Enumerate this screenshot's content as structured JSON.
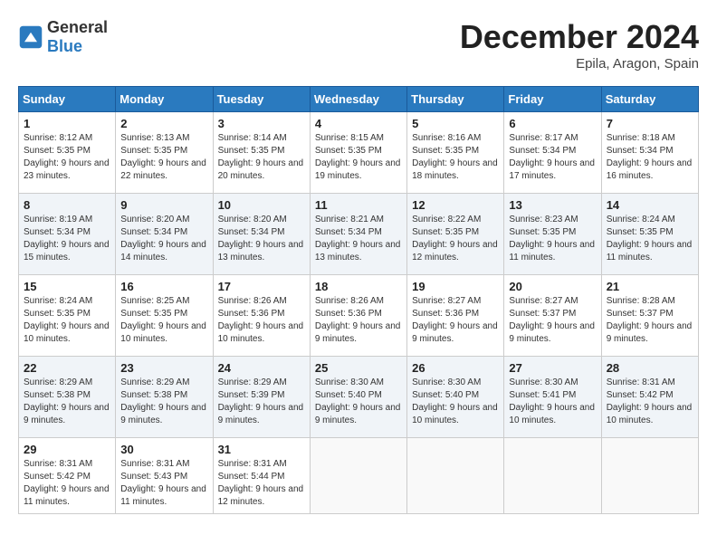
{
  "header": {
    "logo_general": "General",
    "logo_blue": "Blue",
    "month": "December 2024",
    "location": "Epila, Aragon, Spain"
  },
  "weekdays": [
    "Sunday",
    "Monday",
    "Tuesday",
    "Wednesday",
    "Thursday",
    "Friday",
    "Saturday"
  ],
  "weeks": [
    [
      {
        "day": "1",
        "sunrise": "8:12 AM",
        "sunset": "5:35 PM",
        "daylight": "9 hours and 23 minutes."
      },
      {
        "day": "2",
        "sunrise": "8:13 AM",
        "sunset": "5:35 PM",
        "daylight": "9 hours and 22 minutes."
      },
      {
        "day": "3",
        "sunrise": "8:14 AM",
        "sunset": "5:35 PM",
        "daylight": "9 hours and 20 minutes."
      },
      {
        "day": "4",
        "sunrise": "8:15 AM",
        "sunset": "5:35 PM",
        "daylight": "9 hours and 19 minutes."
      },
      {
        "day": "5",
        "sunrise": "8:16 AM",
        "sunset": "5:35 PM",
        "daylight": "9 hours and 18 minutes."
      },
      {
        "day": "6",
        "sunrise": "8:17 AM",
        "sunset": "5:34 PM",
        "daylight": "9 hours and 17 minutes."
      },
      {
        "day": "7",
        "sunrise": "8:18 AM",
        "sunset": "5:34 PM",
        "daylight": "9 hours and 16 minutes."
      }
    ],
    [
      {
        "day": "8",
        "sunrise": "8:19 AM",
        "sunset": "5:34 PM",
        "daylight": "9 hours and 15 minutes."
      },
      {
        "day": "9",
        "sunrise": "8:20 AM",
        "sunset": "5:34 PM",
        "daylight": "9 hours and 14 minutes."
      },
      {
        "day": "10",
        "sunrise": "8:20 AM",
        "sunset": "5:34 PM",
        "daylight": "9 hours and 13 minutes."
      },
      {
        "day": "11",
        "sunrise": "8:21 AM",
        "sunset": "5:34 PM",
        "daylight": "9 hours and 13 minutes."
      },
      {
        "day": "12",
        "sunrise": "8:22 AM",
        "sunset": "5:35 PM",
        "daylight": "9 hours and 12 minutes."
      },
      {
        "day": "13",
        "sunrise": "8:23 AM",
        "sunset": "5:35 PM",
        "daylight": "9 hours and 11 minutes."
      },
      {
        "day": "14",
        "sunrise": "8:24 AM",
        "sunset": "5:35 PM",
        "daylight": "9 hours and 11 minutes."
      }
    ],
    [
      {
        "day": "15",
        "sunrise": "8:24 AM",
        "sunset": "5:35 PM",
        "daylight": "9 hours and 10 minutes."
      },
      {
        "day": "16",
        "sunrise": "8:25 AM",
        "sunset": "5:35 PM",
        "daylight": "9 hours and 10 minutes."
      },
      {
        "day": "17",
        "sunrise": "8:26 AM",
        "sunset": "5:36 PM",
        "daylight": "9 hours and 10 minutes."
      },
      {
        "day": "18",
        "sunrise": "8:26 AM",
        "sunset": "5:36 PM",
        "daylight": "9 hours and 9 minutes."
      },
      {
        "day": "19",
        "sunrise": "8:27 AM",
        "sunset": "5:36 PM",
        "daylight": "9 hours and 9 minutes."
      },
      {
        "day": "20",
        "sunrise": "8:27 AM",
        "sunset": "5:37 PM",
        "daylight": "9 hours and 9 minutes."
      },
      {
        "day": "21",
        "sunrise": "8:28 AM",
        "sunset": "5:37 PM",
        "daylight": "9 hours and 9 minutes."
      }
    ],
    [
      {
        "day": "22",
        "sunrise": "8:29 AM",
        "sunset": "5:38 PM",
        "daylight": "9 hours and 9 minutes."
      },
      {
        "day": "23",
        "sunrise": "8:29 AM",
        "sunset": "5:38 PM",
        "daylight": "9 hours and 9 minutes."
      },
      {
        "day": "24",
        "sunrise": "8:29 AM",
        "sunset": "5:39 PM",
        "daylight": "9 hours and 9 minutes."
      },
      {
        "day": "25",
        "sunrise": "8:30 AM",
        "sunset": "5:40 PM",
        "daylight": "9 hours and 9 minutes."
      },
      {
        "day": "26",
        "sunrise": "8:30 AM",
        "sunset": "5:40 PM",
        "daylight": "9 hours and 10 minutes."
      },
      {
        "day": "27",
        "sunrise": "8:30 AM",
        "sunset": "5:41 PM",
        "daylight": "9 hours and 10 minutes."
      },
      {
        "day": "28",
        "sunrise": "8:31 AM",
        "sunset": "5:42 PM",
        "daylight": "9 hours and 10 minutes."
      }
    ],
    [
      {
        "day": "29",
        "sunrise": "8:31 AM",
        "sunset": "5:42 PM",
        "daylight": "9 hours and 11 minutes."
      },
      {
        "day": "30",
        "sunrise": "8:31 AM",
        "sunset": "5:43 PM",
        "daylight": "9 hours and 11 minutes."
      },
      {
        "day": "31",
        "sunrise": "8:31 AM",
        "sunset": "5:44 PM",
        "daylight": "9 hours and 12 minutes."
      },
      null,
      null,
      null,
      null
    ]
  ]
}
